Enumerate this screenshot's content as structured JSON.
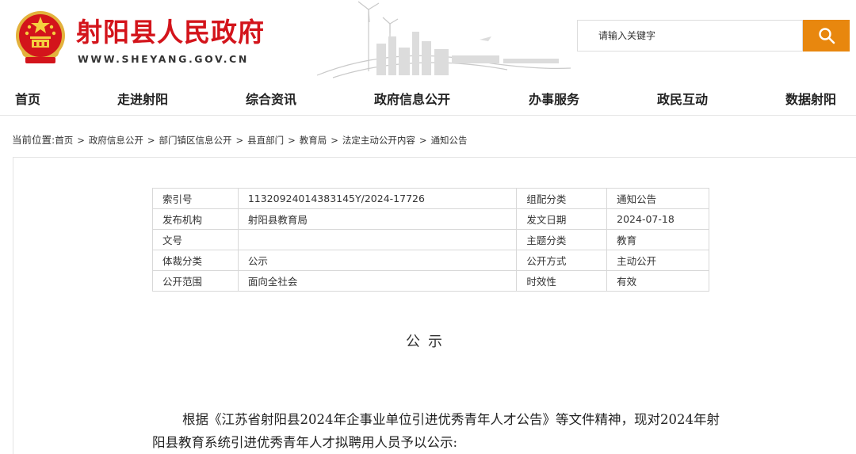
{
  "header": {
    "site_title": "射阳县人民政府",
    "site_url": "WWW.SHEYANG.GOV.CN",
    "emblem_icon": "national-emblem-icon",
    "brand_color": "#d3141b",
    "search": {
      "placeholder": "请输入关键字",
      "button_icon": "search-icon",
      "button_color": "#e8870e"
    }
  },
  "nav": {
    "items": [
      {
        "label": "首页"
      },
      {
        "label": "走进射阳"
      },
      {
        "label": "综合资讯"
      },
      {
        "label": "政府信息公开"
      },
      {
        "label": "办事服务"
      },
      {
        "label": "政民互动"
      },
      {
        "label": "数据射阳"
      }
    ]
  },
  "breadcrumb": {
    "lead": "当前位置:",
    "items": [
      "首页",
      "政府信息公开",
      "部门镇区信息公开",
      "县直部门",
      "教育局",
      "法定主动公开内容",
      "通知公告"
    ],
    "separator": ">"
  },
  "meta_table": {
    "rows": [
      {
        "k1": "索引号",
        "v1": "11320924014383145Y/2024-17726",
        "k2": "组配分类",
        "v2": "通知公告"
      },
      {
        "k1": "发布机构",
        "v1": "射阳县教育局",
        "k2": "发文日期",
        "v2": "2024-07-18"
      },
      {
        "k1": "文号",
        "v1": "",
        "k2": "主题分类",
        "v2": "教育"
      },
      {
        "k1": "体裁分类",
        "v1": "公示",
        "k2": "公开方式",
        "v2": "主动公开"
      },
      {
        "k1": "公开范围",
        "v1": "面向全社会",
        "k2": "时效性",
        "v2": "有效"
      }
    ]
  },
  "notice": {
    "title": "公示",
    "paragraph": "根据《江苏省射阳县2024年企事业单位引进优秀青年人才公告》等文件精神，现对2024年射阳县教育系统引进优秀青年人才拟聘用人员予以公示:"
  }
}
